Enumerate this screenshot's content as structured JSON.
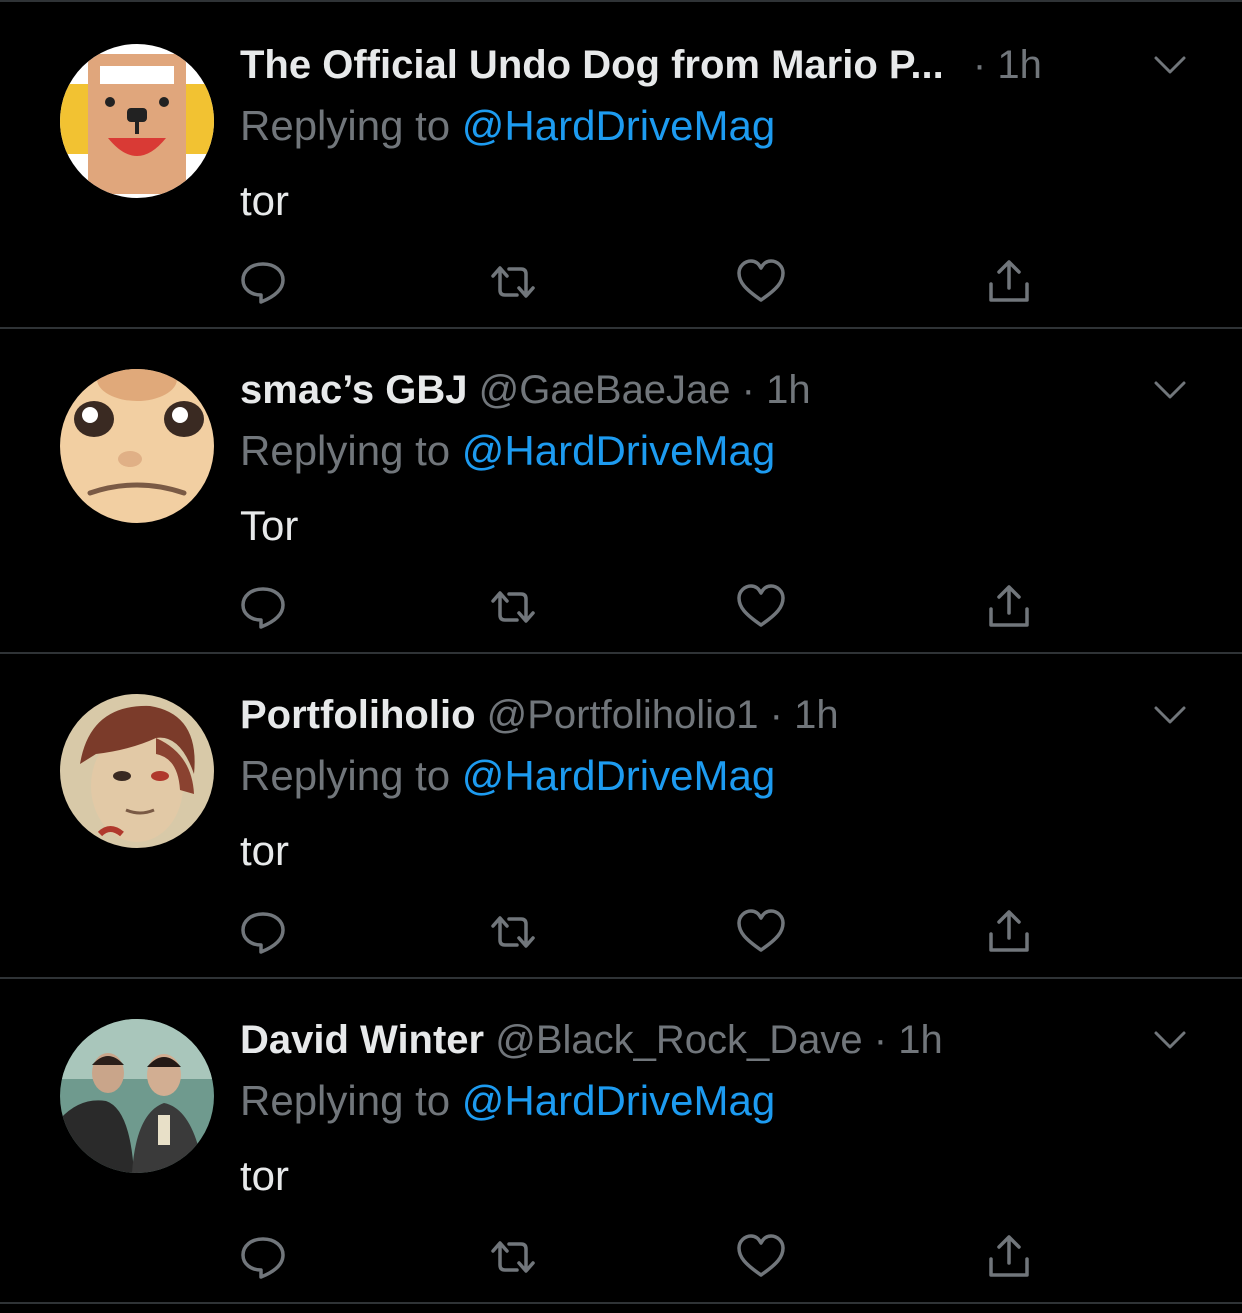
{
  "colors": {
    "background": "#000000",
    "divider": "#2f3336",
    "name": "#e7e9ea",
    "secondary": "#71767b",
    "mention": "#1d9bf0"
  },
  "tweets": [
    {
      "name": "The Official Undo Dog from Mario P...",
      "handle": "",
      "dot": "·",
      "time": "1h",
      "replying_prefix": "Replying to ",
      "replying_to": "@HardDriveMag",
      "text": "tor",
      "avatar": "undo-dog-avatar"
    },
    {
      "name": "smac’s GBJ",
      "handle": "@GaeBaeJae",
      "dot": "·",
      "time": "1h",
      "replying_prefix": "Replying to ",
      "replying_to": "@HardDriveMag",
      "text": "Tor",
      "avatar": "face-avatar"
    },
    {
      "name": "Portfoliholio",
      "handle": "@Portfoliholio1",
      "dot": "·",
      "time": "1h",
      "replying_prefix": "Replying to ",
      "replying_to": "@HardDriveMag",
      "text": "tor",
      "avatar": "portrait-avatar"
    },
    {
      "name": "David Winter",
      "handle": "@Black_Rock_Dave",
      "dot": "·",
      "time": "1h",
      "replying_prefix": "Replying to ",
      "replying_to": "@HardDriveMag",
      "text": "tor",
      "avatar": "photo-avatar"
    }
  ],
  "icons": {
    "reply": "reply-icon",
    "retweet": "retweet-icon",
    "like": "heart-icon",
    "share": "share-icon",
    "more": "chevron-down-icon"
  }
}
